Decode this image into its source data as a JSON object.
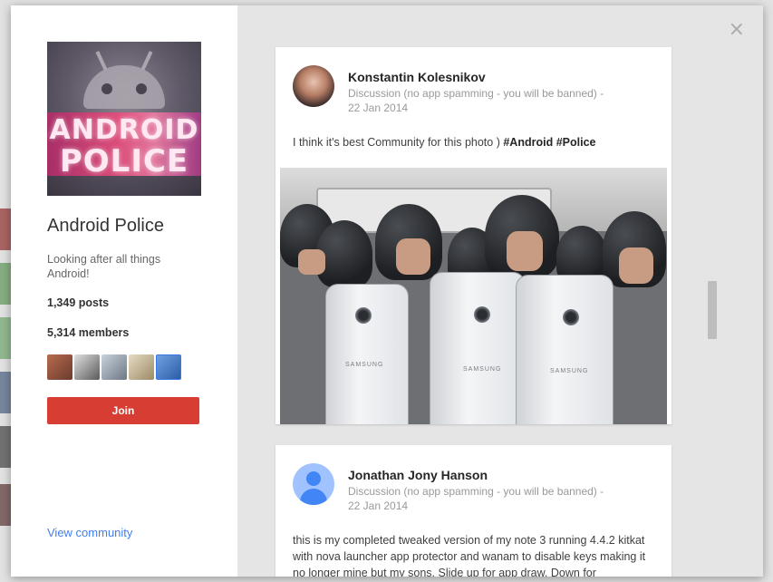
{
  "colors": {
    "join_button": "#d73d32",
    "link": "#427fed",
    "modal_background": "#e5e5e5"
  },
  "modal": {
    "close_icon": "close-icon",
    "close_glyph": "×"
  },
  "community": {
    "name": "Android Police",
    "tagline": "Looking after all things Android!",
    "posts": "1,349 posts",
    "members": "5,314 members",
    "member_avatars": [
      "member-avatar-1",
      "member-avatar-2",
      "member-avatar-3",
      "member-avatar-4",
      "member-avatar-5"
    ],
    "join_label": "Join",
    "view_community_label": "View community",
    "cover_logo_line1": "ANDROID",
    "cover_logo_line2": "POLICE"
  },
  "posts": [
    {
      "author": "Konstantin Kolesnikov",
      "category": "Discussion (no app spamming - you will be banned)",
      "separator": "-",
      "date": "22 Jan 2014",
      "text": "I think it's best Community for this photo )",
      "hashtags": [
        "#Android",
        "#Police"
      ],
      "photo_brand": "SAMSUNG"
    },
    {
      "author": "Jonathan Jony Hanson",
      "category": "Discussion (no app spamming - you will be banned)",
      "separator": "-",
      "date": "22 Jan 2014",
      "text": "this is my completed tweaked version of my note 3 running 4.4.2 kitkat with nova launcher app protector and wanam to disable keys making it no longer mine but my sons. Slide up for app draw. Down for"
    }
  ]
}
